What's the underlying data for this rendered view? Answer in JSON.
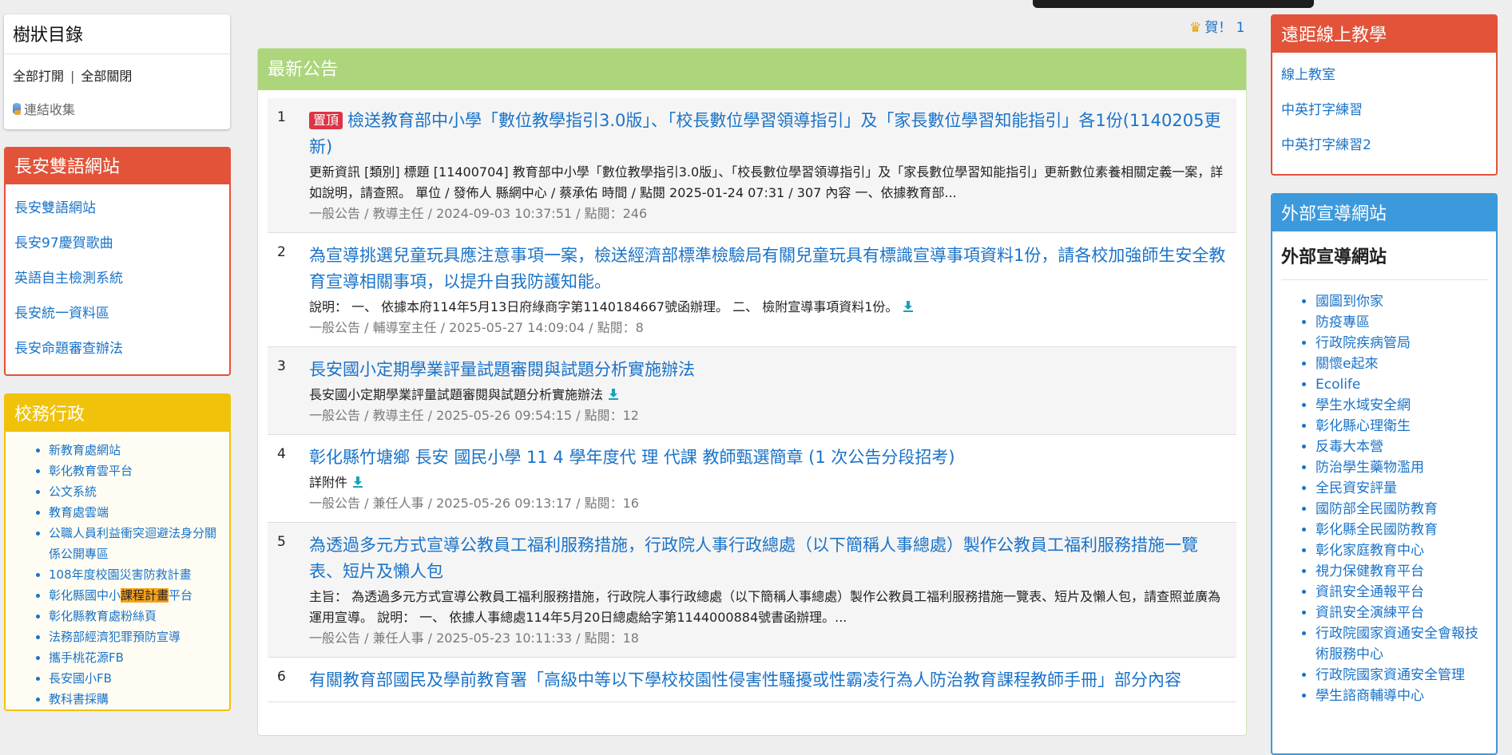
{
  "tree": {
    "title": "樹狀目錄",
    "expand_all": "全部打開",
    "separator": "|",
    "collapse_all": "全部關閉",
    "link_collection": "連結收集"
  },
  "bilingual": {
    "title": "長安雙語網站",
    "items": [
      "長安雙語網站",
      "長安97慶賀歌曲",
      "英語自主檢測系統",
      "長安統一資料區",
      "長安命題審查辦法"
    ]
  },
  "admin": {
    "title": "校務行政",
    "items": [
      "新教育處網站",
      "彰化教育雲平台",
      "公文系統",
      "教育處雲端",
      "公職人員利益衝突迴避法身分關係公開專區",
      "108年度校園災害防救計畫"
    ],
    "course_item": {
      "before": "彰化縣國中小",
      "highlight": "課程計畫",
      "after": "平台"
    },
    "items2": [
      "彰化縣教育處粉絲頁",
      "法務部經濟犯罪預防宣導",
      "攜手桃花源FB",
      "長安國小FB",
      "教科書採購"
    ]
  },
  "congrats": {
    "icon": "crown-icon",
    "text": "賀！ 1"
  },
  "announcements": {
    "header": "最新公告",
    "pin_label": "置頂",
    "items": [
      {
        "num": "1",
        "title": "檢送教育部中小學「數位教學指引3.0版」、「校長數位學習領導指引」及「家長數位學習知能指引」各1份(1140205更新)",
        "desc": "更新資訊 [類別] 標題 [11400704] 教育部中小學「數位教學指引3.0版」、「校長數位學習領導指引」及「家長數位學習知能指引」更新數位素養相關定義一案，詳如說明，請查照。 單位 / 發佈人 縣網中心 / 蔡承佑 時間 / 點閱 2025-01-24 07:31 / 307 內容 一、依據教育部...",
        "meta": "一般公告 / 教導主任 / 2024-09-03 10:37:51 / 點閱：246"
      },
      {
        "num": "2",
        "title": "為宣導挑選兒童玩具應注意事項一案，檢送經濟部標準檢驗局有關兒童玩具有標識宣導事項資料1份，請各校加強師生安全教育宣導相關事項，以提升自我防護知能。",
        "desc": "說明： 一、 依據本府114年5月13日府綠商字第1140184667號函辦理。 二、 檢附宣導事項資料1份。",
        "meta": "一般公告 / 輔導室主任 / 2025-05-27 14:09:04 / 點閱：8"
      },
      {
        "num": "3",
        "title": "長安國小定期學業評量試題審閱與試題分析實施辦法",
        "desc": "長安國小定期學業評量試題審閱與試題分析實施辦法",
        "meta": "一般公告 / 教導主任 / 2025-05-26 09:54:15 / 點閱：12"
      },
      {
        "num": "4",
        "title": "彰化縣竹塘鄉 長安 國民小學 11 4 學年度代 理 代課 教師甄選簡章 (1 次公告分段招考)",
        "desc": "詳附件",
        "meta": "一般公告 / 兼任人事 / 2025-05-26 09:13:17 / 點閱：16"
      },
      {
        "num": "5",
        "title": "為透過多元方式宣導公教員工福利服務措施，行政院人事行政總處（以下簡稱人事總處）製作公教員工福利服務措施一覽表、短片及懶人包",
        "desc": "主旨： 為透過多元方式宣導公教員工福利服務措施，行政院人事行政總處（以下簡稱人事總處）製作公教員工福利服務措施一覽表、短片及懶人包，請查照並廣為運用宣導。 說明： 一、 依據人事總處114年5月20日總處給字第1144000884號書函辦理。...",
        "meta": "一般公告 / 兼任人事 / 2025-05-23 10:11:33 / 點閱：18"
      },
      {
        "num": "6",
        "title": "有關教育部國民及學前教育署「高級中等以下學校校園性侵害性騷擾或性霸凌行為人防治教育課程教師手冊」部分內容",
        "desc": "",
        "meta": ""
      }
    ]
  },
  "remote": {
    "title": "遠距線上教學",
    "items": [
      "線上教室",
      "中英打字練習",
      "中英打字練習2"
    ]
  },
  "external": {
    "title": "外部宣導網站",
    "subtitle": "外部宣導網站",
    "items": [
      "國圖到你家",
      "防疫專區",
      "行政院疾病管局",
      "關懷e起來",
      "Ecolife",
      "學生水域安全網",
      "彰化縣心理衛生",
      "反毒大本營",
      "防治學生藥物濫用",
      "全民資安評量",
      "國防部全民國防教育",
      "彰化縣全民國防教育",
      "彰化家庭教育中心",
      "視力保健教育平台",
      "資訊安全通報平台",
      "資訊安全演練平台",
      "行政院國家資通安全會報技術服務中心",
      "行政院國家資通安全管理",
      "學生諮商輔導中心"
    ]
  }
}
